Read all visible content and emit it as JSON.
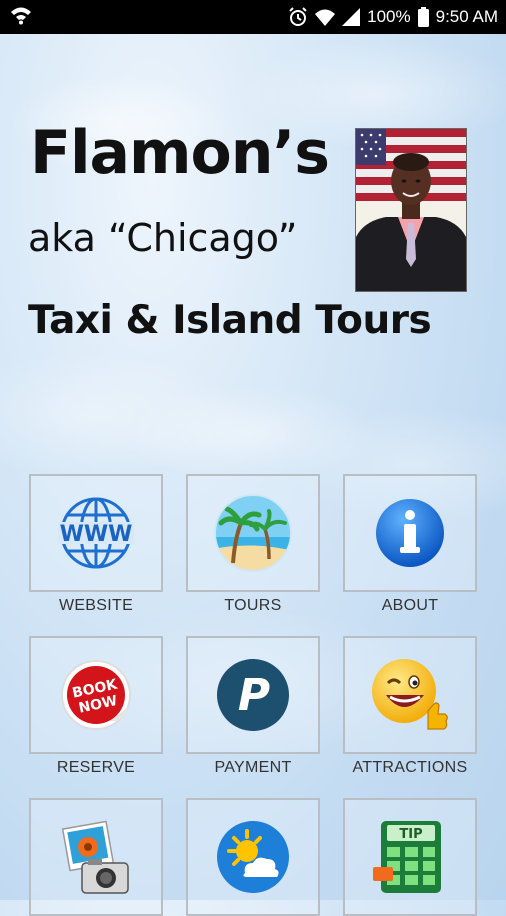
{
  "status_bar": {
    "battery": "100%",
    "time": "9:50 AM"
  },
  "header": {
    "title": "Flamon’s",
    "subtitle": "aka “Chicago”",
    "tagline": "Taxi & Island Tours"
  },
  "menu": {
    "items": [
      {
        "label": "WEBSITE",
        "icon": "www-globe-icon"
      },
      {
        "label": "TOURS",
        "icon": "palm-beach-icon"
      },
      {
        "label": "ABOUT",
        "icon": "info-icon"
      },
      {
        "label": "RESERVE",
        "icon": "book-now-sticker-icon"
      },
      {
        "label": "PAYMENT",
        "icon": "paypal-p-icon"
      },
      {
        "label": "ATTRACTIONS",
        "icon": "smiley-thumbs-up-icon"
      },
      {
        "label": "",
        "icon": "photo-camera-icon"
      },
      {
        "label": "",
        "icon": "weather-sun-cloud-icon"
      },
      {
        "label": "",
        "icon": "tip-calculator-icon"
      }
    ]
  },
  "colors": {
    "status_bar_bg": "#000000",
    "tile_border": "#b9bec4",
    "sky_blue": "#c4dcf2"
  }
}
